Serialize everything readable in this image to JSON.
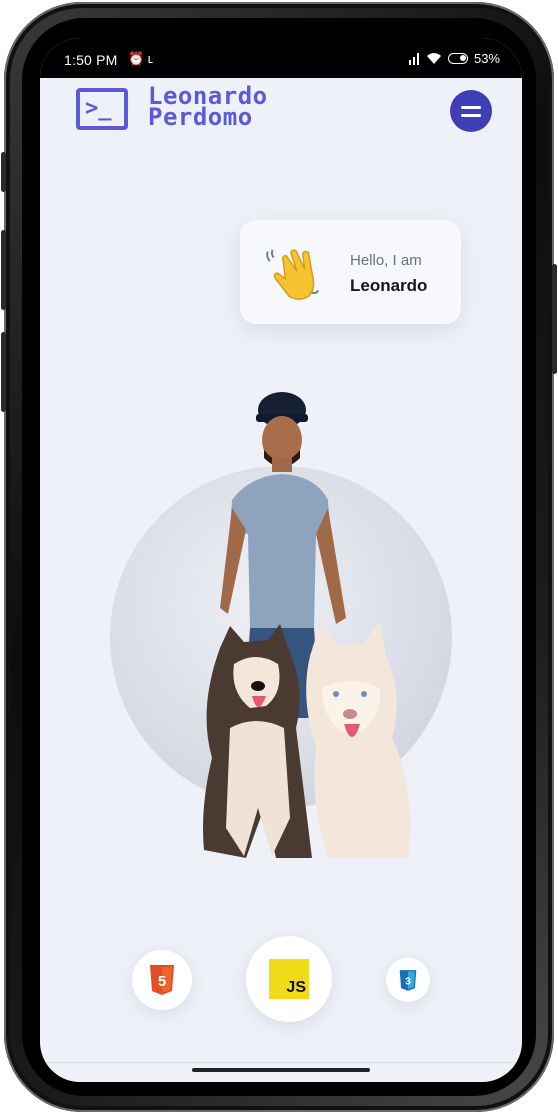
{
  "status_bar": {
    "time": "1:50 PM",
    "left_icons": "⏰ ʟ",
    "signal": "❙❙",
    "wifi_icon": "wifi-icon",
    "battery": "53%"
  },
  "header": {
    "logo_prompt": ">_",
    "brand_line1": "Leonardo",
    "brand_line2": "Perdomo",
    "menu_icon": "hamburger-menu-icon"
  },
  "greeting": {
    "emoji_icon": "waving-hand-icon",
    "hello": "Hello, I am",
    "name": "Leonardo"
  },
  "hero": {
    "image": "man-with-two-husky-dogs"
  },
  "skills": [
    {
      "name": "html5-icon",
      "label": "5"
    },
    {
      "name": "javascript-icon",
      "label": "JS"
    },
    {
      "name": "css3-icon",
      "label": "3"
    }
  ],
  "colors": {
    "accent": "#5b5bd8",
    "menu": "#3f3fb5",
    "background": "#eef1f7",
    "html": "#e44d26",
    "js": "#f0db1a",
    "css": "#1572b6"
  }
}
